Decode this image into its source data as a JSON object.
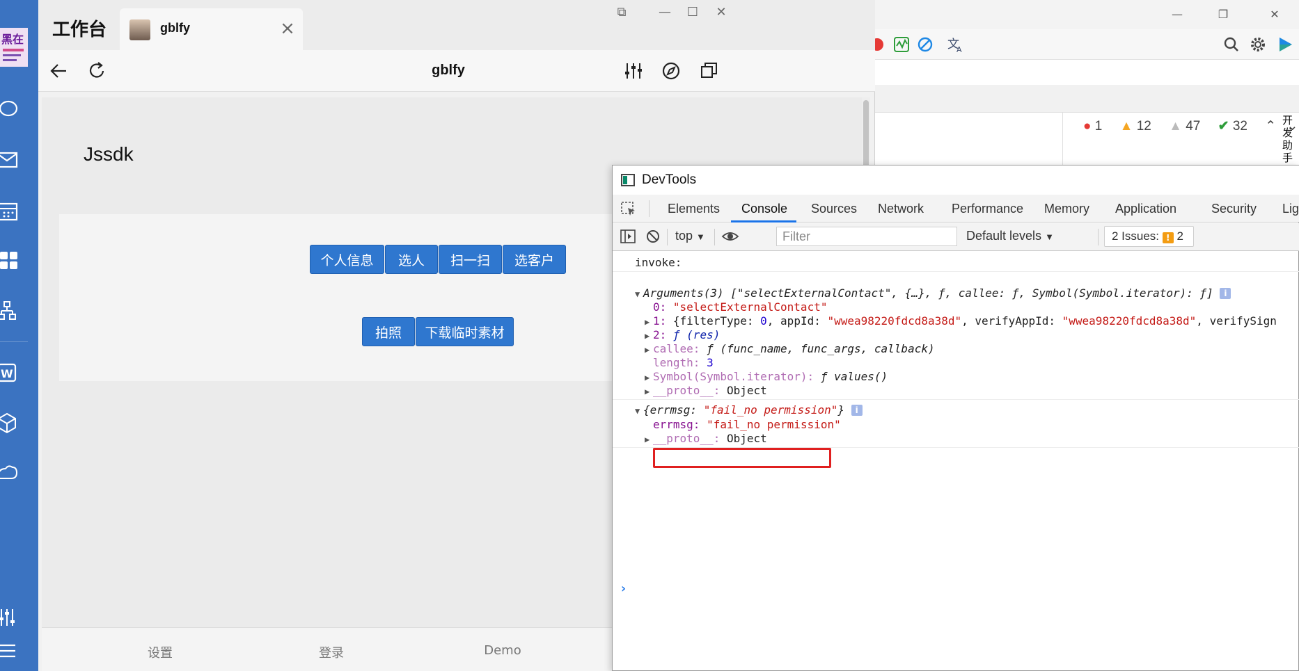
{
  "app": {
    "brand": "工作台",
    "tab_title": "gblfy",
    "nav_title": "gblfy",
    "content_heading": "Jssdk",
    "buttons_row1": [
      "个人信息",
      "选人",
      "扫一扫",
      "选客户"
    ],
    "buttons_row2": [
      "拍照",
      "下载临时素材"
    ],
    "bottom_nav": [
      "设置",
      "登录",
      "Demo"
    ]
  },
  "browser": {
    "issue_counts": {
      "errors": "1",
      "warnings": "12",
      "info": "47",
      "passed": "32"
    },
    "helper_label": "开发助手"
  },
  "devtools": {
    "title": "DevTools",
    "tabs": [
      "Elements",
      "Console",
      "Sources",
      "Network",
      "Performance",
      "Memory",
      "Application",
      "Security",
      "Lig"
    ],
    "active_tab": "Console",
    "context": "top",
    "filter_placeholder": "Filter",
    "levels": "Default levels",
    "issues_label": "2 Issues:",
    "issues_count": "2",
    "console": {
      "invoke": "invoke:",
      "args_head": "Arguments(3) [\"selectExternalContact\", {…}, ƒ, callee: ƒ, Symbol(Symbol.iterator): ƒ]",
      "args_0_key": "0:",
      "args_0_val": "\"selectExternalContact\"",
      "args_1_key": "1:",
      "args_1_pre": "{filterType: ",
      "args_1_num": "0",
      "args_1_mid": ", appId: ",
      "args_1_appid": "\"wwea98220fdcd8a38d\"",
      "args_1_mid2": ", verifyAppId: ",
      "args_1_verify": "\"wwea98220fdcd8a38d\"",
      "args_1_tail": ", verifySign",
      "args_2_key": "2:",
      "args_2_val": "ƒ (res)",
      "callee_key": "callee:",
      "callee_val": "ƒ (func_name, func_args, callback)",
      "length_key": "length:",
      "length_val": "3",
      "symbol_key": "Symbol(Symbol.iterator):",
      "symbol_val": "ƒ values()",
      "proto_key": "__proto__:",
      "proto_val": "Object",
      "err_head_pre": "{errmsg: ",
      "err_head_val": "\"fail_no permission\"",
      "err_head_post": "}",
      "err_key": "errmsg:",
      "err_val": "\"fail_no permission\"",
      "proto2_key": "__proto__:",
      "proto2_val": "Object",
      "prompt": "›"
    }
  },
  "colors": {
    "sidebar": "#3b73c1",
    "primary_button": "#2f77cf",
    "highlight": "#e02020",
    "devtools_accent": "#1a73e8"
  }
}
